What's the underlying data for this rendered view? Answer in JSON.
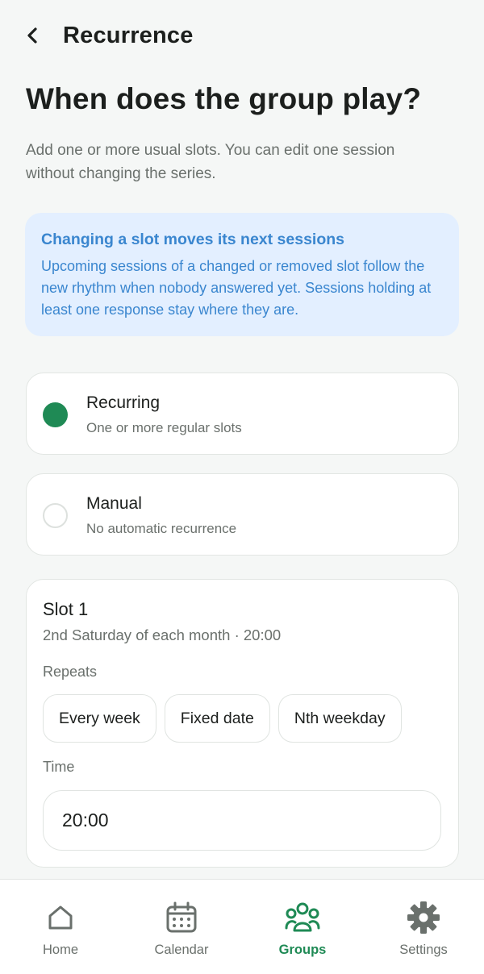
{
  "header": {
    "title": "Recurrence",
    "back_icon": "chevron-left-icon"
  },
  "page": {
    "heading": "When does the group play?",
    "subtitle": "Add one or more usual slots. You can edit one session without changing the series."
  },
  "info": {
    "title": "Changing a slot moves its next sessions",
    "text": "Upcoming sessions of a changed or removed slot follow the new rhythm when nobody answered yet. Sessions holding at least one response stay where they are."
  },
  "mode_options": [
    {
      "label": "Recurring",
      "description": "One or more regular slots",
      "selected": true
    },
    {
      "label": "Manual",
      "description": "No automatic recurrence",
      "selected": false
    }
  ],
  "slot": {
    "title": "Slot 1",
    "summary": "2nd Saturday of each month · 20:00",
    "repeats_label": "Repeats",
    "repeat_options": [
      "Every week",
      "Fixed date",
      "Nth weekday"
    ],
    "time_label": "Time",
    "time_value": "20:00"
  },
  "bottom_nav": {
    "items": [
      {
        "label": "Home",
        "icon": "home-icon",
        "active": false
      },
      {
        "label": "Calendar",
        "icon": "calendar-icon",
        "active": false
      },
      {
        "label": "Groups",
        "icon": "groups-icon",
        "active": true
      },
      {
        "label": "Settings",
        "icon": "gear-icon",
        "active": false
      }
    ]
  },
  "colors": {
    "accent": "#1f8a55",
    "info_background": "#e3efff",
    "info_text": "#3a86cf",
    "background": "#f5f7f6"
  }
}
